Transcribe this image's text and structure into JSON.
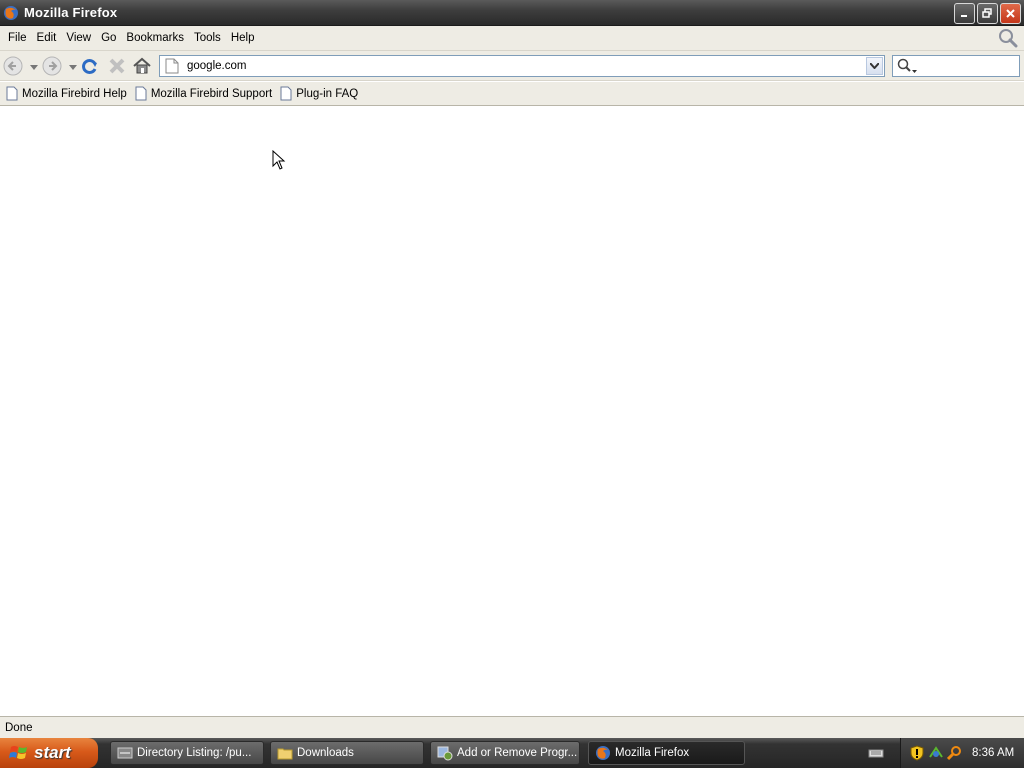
{
  "window": {
    "title": "Mozilla Firefox"
  },
  "menu": {
    "items": [
      {
        "label": "File"
      },
      {
        "label": "Edit"
      },
      {
        "label": "View"
      },
      {
        "label": "Go"
      },
      {
        "label": "Bookmarks"
      },
      {
        "label": "Tools"
      },
      {
        "label": "Help"
      }
    ]
  },
  "navigation": {
    "url": "google.com",
    "search_value": ""
  },
  "bookmarks": [
    {
      "label": "Mozilla Firebird Help"
    },
    {
      "label": "Mozilla Firebird Support"
    },
    {
      "label": "Plug-in FAQ"
    }
  ],
  "status": {
    "text": "Done"
  },
  "taskbar": {
    "start_label": "start",
    "tasks": [
      {
        "label": "Directory Listing: /pu...",
        "icon": "ftp-icon"
      },
      {
        "label": "Downloads",
        "icon": "folder-icon"
      },
      {
        "label": "Add or Remove Progr...",
        "icon": "add-remove-icon"
      },
      {
        "label": "Mozilla Firefox",
        "icon": "firefox-icon"
      }
    ],
    "clock": "8:36 AM"
  },
  "colors": {
    "chrome": "#eeece4",
    "titlebar": "#3e3e3e",
    "start": "#d85a1a"
  }
}
